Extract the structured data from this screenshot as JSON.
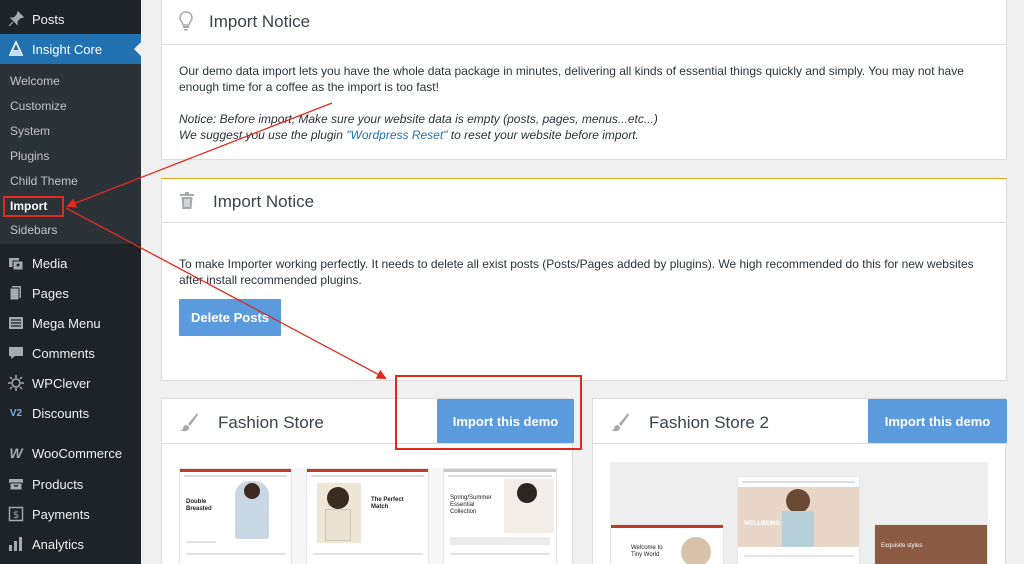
{
  "sidebar": {
    "menu": [
      {
        "label": "Posts",
        "icon": "pushpin-icon"
      },
      {
        "label": "Insight Core",
        "icon": "insight-core-icon"
      },
      {
        "label": "Media",
        "icon": "media-icon"
      },
      {
        "label": "Pages",
        "icon": "pages-icon"
      },
      {
        "label": "Mega Menu",
        "icon": "mega-menu-icon"
      },
      {
        "label": "Comments",
        "icon": "comments-icon"
      },
      {
        "label": "WPClever",
        "icon": "wpclever-icon"
      },
      {
        "label": "Discounts",
        "icon": "discounts-icon"
      },
      {
        "label": "WooCommerce",
        "icon": "woocommerce-icon"
      },
      {
        "label": "Products",
        "icon": "products-icon"
      },
      {
        "label": "Payments",
        "icon": "payments-icon"
      },
      {
        "label": "Analytics",
        "icon": "analytics-icon"
      }
    ],
    "submenu": [
      "Welcome",
      "Customize",
      "System",
      "Plugins",
      "Child Theme",
      "Import",
      "Sidebars"
    ],
    "current_submenu": "Import"
  },
  "notice1": {
    "title": "Import Notice",
    "paragraph": "Our demo data import lets you have the whole data package in minutes, delivering all kinds of essential things quickly and simply. You may not have enough time for a coffee as the import is too fast!",
    "notice_line1": "Notice: Before import, Make sure your website data is empty (posts, pages, menus...etc...)",
    "notice_line2_prefix": "We suggest you use the plugin ",
    "notice_link": "\"Wordpress Reset\"",
    "notice_line2_suffix": " to reset your website before import."
  },
  "notice2": {
    "title": "Import Notice",
    "paragraph": "To make Importer working perfectly. It needs to delete all exist posts (Posts/Pages added by plugins). We high recommended do this for new websites after install recommended plugins.",
    "button": "Delete Posts"
  },
  "demos": [
    {
      "title": "Fashion Store",
      "button": "Import this demo"
    },
    {
      "title": "Fashion Store 2",
      "button": "Import this demo"
    }
  ],
  "thumbs": {
    "t1": "Double Breasted",
    "t2": "The Perfect Match",
    "t3": "Spring/Summer Essential Collection",
    "t4": "Welcome to Tiny World",
    "t5": "WELLBEING",
    "t6": "Exquisite styles"
  },
  "colors": {
    "sidebar_bg": "#1d2327",
    "accent": "#2271b1",
    "button_blue": "#5b9bdd",
    "annotation_red": "#e02a1c"
  }
}
